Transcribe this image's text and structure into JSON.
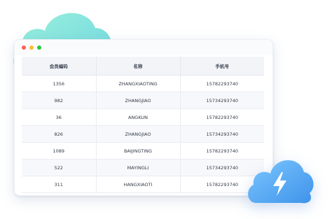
{
  "colors": {
    "cloud_back": "#7fe0d3",
    "cloud_front": "#4aa8f0",
    "titlebar_red": "#ff5f57",
    "titlebar_yellow": "#febc2e",
    "titlebar_green": "#28c840"
  },
  "icons": [
    "lightning-bolt-icon"
  ],
  "table": {
    "headers": [
      "会员编码",
      "名称",
      "手机号"
    ],
    "rows": [
      [
        "1356",
        "ZHANGXIAOTING",
        "15782293740"
      ],
      [
        "982",
        "ZHANGJIAO",
        "15734293740"
      ],
      [
        "36",
        "ANGKUN",
        "15782293740"
      ],
      [
        "826",
        "ZHANGJIAO",
        "15734293740"
      ],
      [
        "1089",
        "BAIJINGTING",
        "15782293740"
      ],
      [
        "522",
        "MAYINGLI",
        "15734293740"
      ],
      [
        "311",
        "HANGXIAOTI",
        "15782293740"
      ]
    ]
  }
}
